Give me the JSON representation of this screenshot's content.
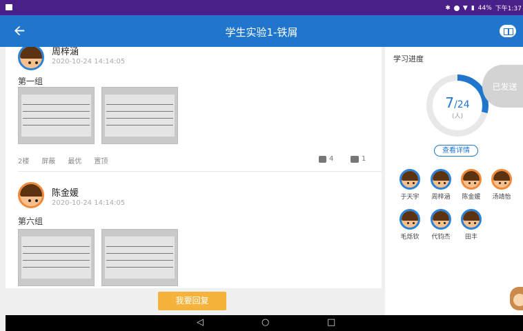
{
  "status_bar": {
    "battery": "44%",
    "time": "下午1:37"
  },
  "app_bar": {
    "back_glyph": "🡨",
    "title": "学生实验1-铁屑"
  },
  "posts": [
    {
      "name": "周梓涵",
      "time": "2020-10-24 14:14:05",
      "group": "第一组",
      "floor": "2楼",
      "actions": [
        "屏蔽",
        "最优",
        "置顶"
      ],
      "likes": "4",
      "comments": "1"
    },
    {
      "name": "陈金媛",
      "time": "2020-10-24 14:14:05",
      "group": "第六组"
    }
  ],
  "progress": {
    "title": "学习进度",
    "done": "7",
    "total": "/24",
    "unit": "(人)",
    "fraction": 0.29,
    "sent_label": "已发送",
    "details_label": "查看详情"
  },
  "students": [
    "于天宇",
    "周梓涵",
    "陈金媛",
    "汤靖怡",
    "毛烁钦",
    "代钧杰",
    "田丰"
  ],
  "reply_label": "我要回复",
  "nav": {
    "back": "◁",
    "home": "○",
    "recent": "□"
  },
  "colors": {
    "primary": "#1f76cc",
    "reply": "#f5b33b",
    "statusbar": "#4a1f8a"
  }
}
